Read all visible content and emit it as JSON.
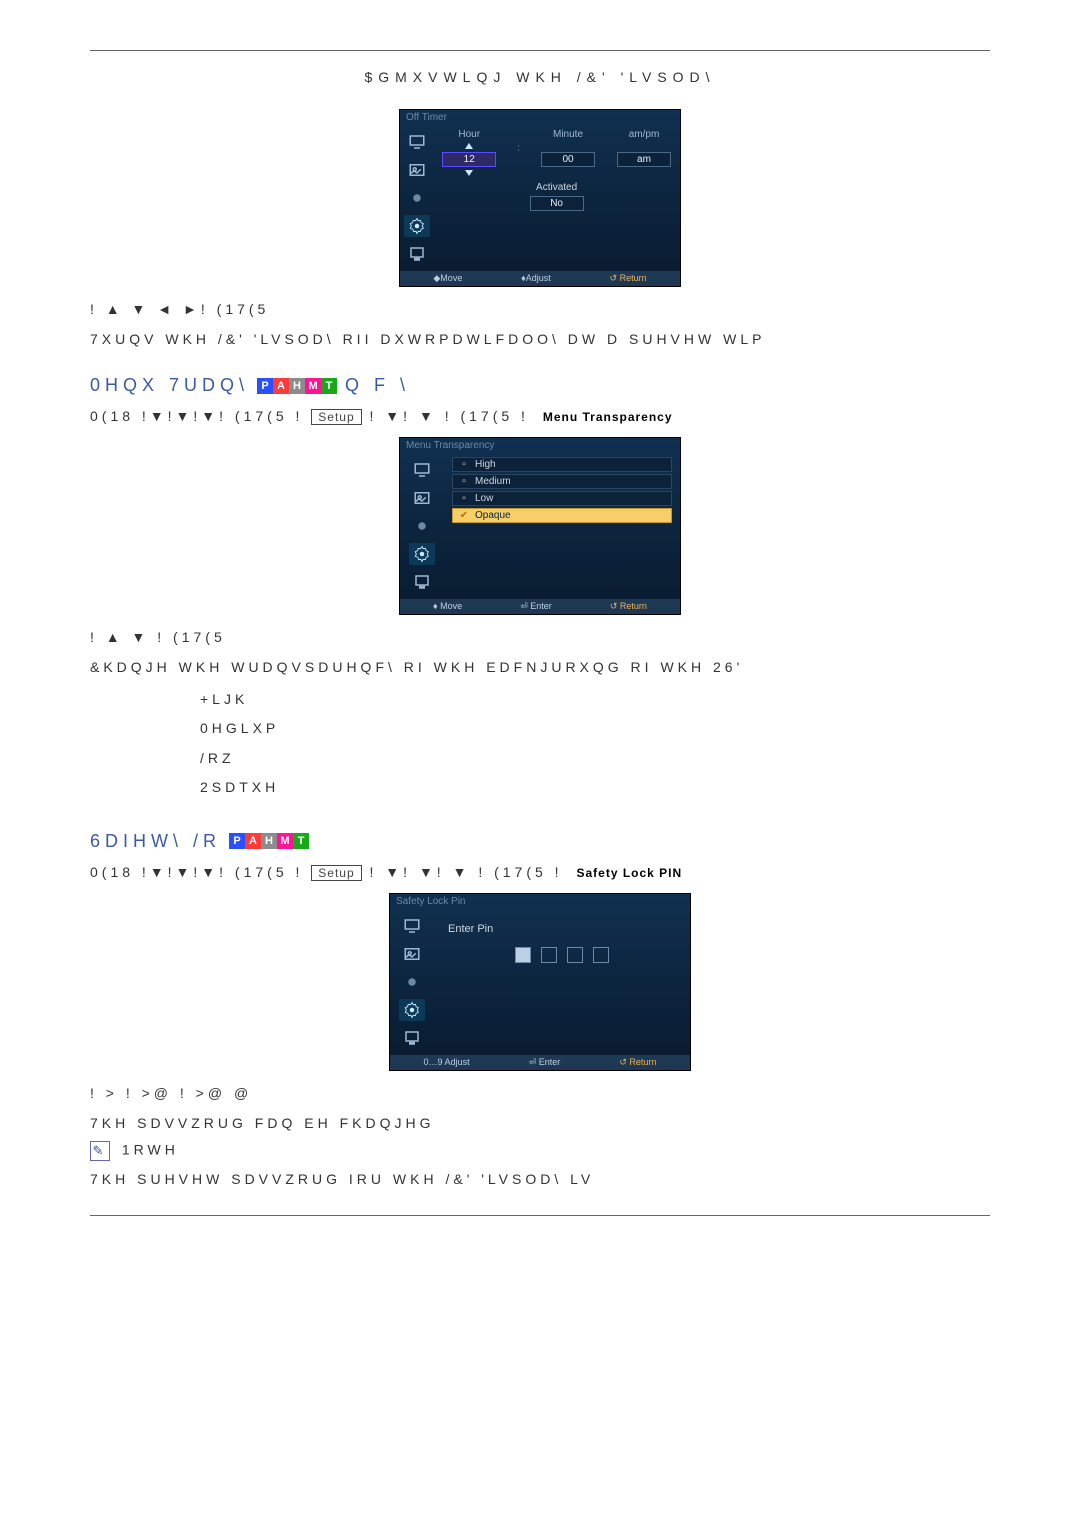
{
  "page": {
    "title": "$GMXVWLQJ WKH /&' 'LVSOD\\"
  },
  "offTimer": {
    "osdTitle": "Off Timer",
    "cols": {
      "hour": "Hour",
      "minute": "Minute",
      "ampm": "am/pm"
    },
    "vals": {
      "hour": "12",
      "minute": "00",
      "ampm": "am"
    },
    "activatedLabel": "Activated",
    "activatedValue": "No",
    "footer": {
      "move": "◆Move",
      "adjust": "♦Adjust",
      "return": "↺ Return"
    },
    "nav": "! ▲ ▼ ◄ ►! (17(5",
    "desc": "7XUQV WKH /&' 'LVSOD\\ RII DXWRPDWLFDOO\\ DW D SUHVHW WLP"
  },
  "menuTransparency": {
    "heading": "0HQX 7UDQ\\",
    "headingTail": "Q F \\",
    "menuPath1": "0(18 !▼!▼!▼! (17(5 !",
    "pillSetup": "Setup",
    "menuPath2": " ! ▼! ▼ ! (17(5 !",
    "pillEnd": "Menu Transparency",
    "osdTitle": "Menu Transparency",
    "items": [
      "High",
      "Medium",
      "Low",
      "Opaque"
    ],
    "selectedIndex": 3,
    "footer": {
      "move": "♦ Move",
      "enter": "⏎ Enter",
      "return": "↺ Return"
    },
    "nav": "! ▲ ▼ ! (17(5",
    "desc": "&KDQJH WKH WUDQVSDUHQF\\ RI WKH EDFNJURXQG RI WKH 26'",
    "bullets": {
      "high": "+LJK",
      "medium": "0HGLXP",
      "low": "/RZ",
      "opaque": "2SDTXH"
    }
  },
  "safetyLock": {
    "heading": "6DIHW\\ /R",
    "menuPath1": "0(18 !▼!▼!▼! (17(5 !",
    "pillSetup": "Setup",
    "menuPath2": " ! ▼! ▼! ▼ ! (17(5 !",
    "pillEnd": "Safety Lock PIN",
    "osdTitle": "Safety Lock Pin",
    "enterPin": "Enter Pin",
    "footer": {
      "adjust": "0…9 Adjust",
      "enter": "⏎ Enter",
      "return": "↺ Return"
    },
    "nav": "! >                       ! >@                        ! >@                           @",
    "desc": "7KH SDVVZRUG FDQ EH FKDQJHG",
    "noteLabel": "1RWH",
    "noteText": "7KH SUHVHW SDVVZRUG IRU WKH /&' 'LVSOD\\ LV"
  }
}
